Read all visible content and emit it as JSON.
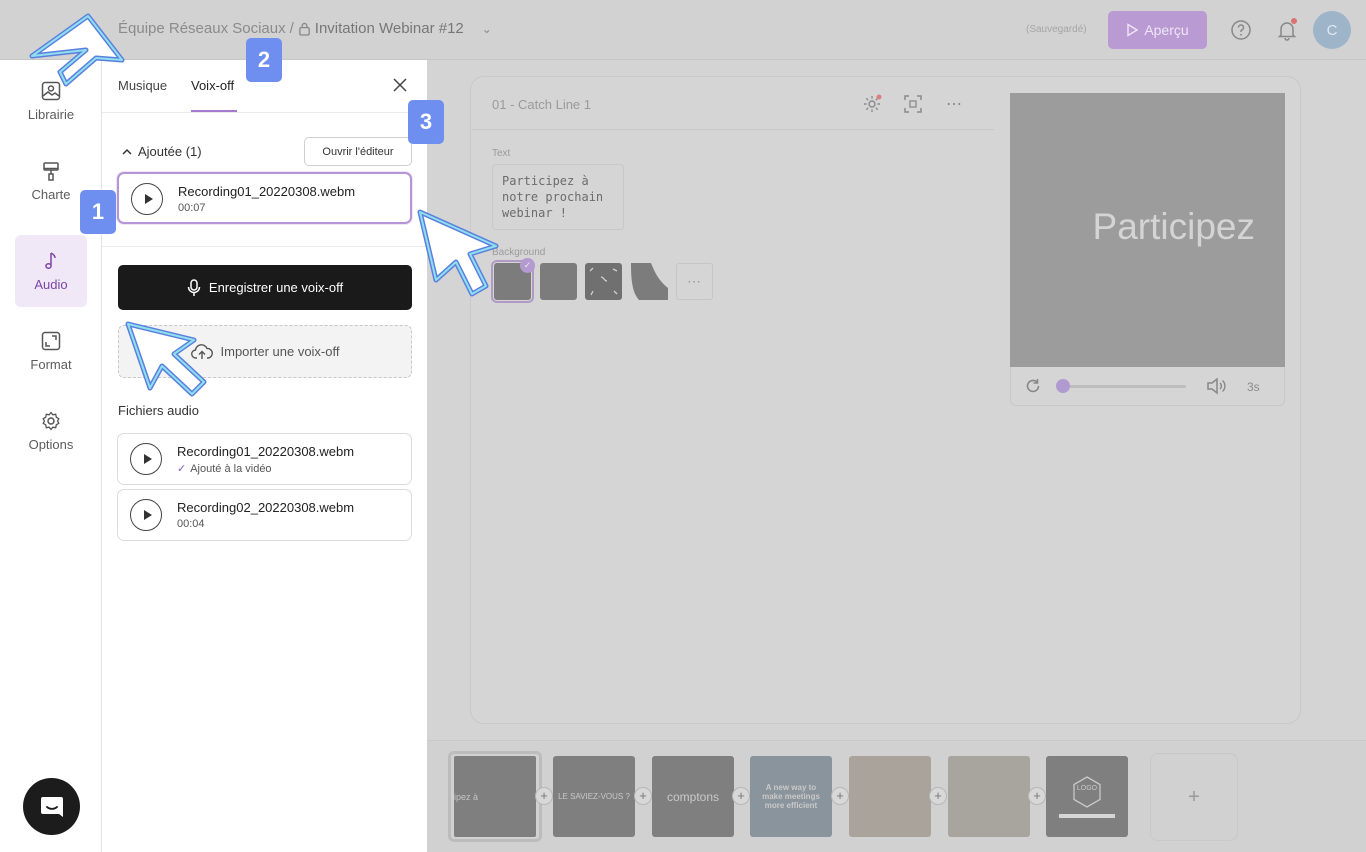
{
  "header": {
    "team": "Équipe Réseaux Sociaux",
    "separator": "/",
    "project": "Invitation Webinar #12",
    "saved_status": "(Sauvegardé)",
    "preview_label": "Aperçu",
    "avatar_initial": "C"
  },
  "nav": {
    "items": [
      {
        "label": "Librairie",
        "icon": "library-icon"
      },
      {
        "label": "Charte",
        "icon": "paint-roller-icon"
      },
      {
        "label": "Audio",
        "icon": "music-note-icon",
        "active": true
      },
      {
        "label": "Format",
        "icon": "resize-icon"
      },
      {
        "label": "Options",
        "icon": "gear-icon"
      }
    ]
  },
  "panel": {
    "tabs": [
      "Musique",
      "Voix-off"
    ],
    "active_tab": "Voix-off",
    "added_label": "Ajoutée (1)",
    "open_editor_label": "Ouvrir l'éditeur",
    "added_item": {
      "name": "Recording01_20220308.webm",
      "duration": "00:07"
    },
    "record_label": "Enregistrer une voix-off",
    "import_label": "Importer une voix-off",
    "files_title": "Fichiers audio",
    "files": [
      {
        "name": "Recording01_20220308.webm",
        "sub": "Ajouté à la vidéo",
        "added": true
      },
      {
        "name": "Recording02_20220308.webm",
        "sub": "00:04",
        "added": false
      }
    ]
  },
  "editor": {
    "slide_title": "01 - Catch Line 1",
    "text_label": "Text",
    "text_value": "Participez à\nnotre prochain\nwebinar !",
    "background_label": "Background",
    "preview_text": "Participez",
    "duration": "3s"
  },
  "filmstrip": {
    "thumbs": [
      "ipez à",
      "LE SAVIEZ-VOUS ?",
      "comptons",
      "A new way to make meetings more efficient",
      "",
      "",
      "LOGO"
    ],
    "add_symbol": "+"
  },
  "overlay": {
    "badges": [
      "1",
      "2",
      "3"
    ]
  },
  "colors": {
    "accent": "#a57bcf",
    "badge": "#6f8ff0",
    "dark_button": "#1a1a1a"
  }
}
